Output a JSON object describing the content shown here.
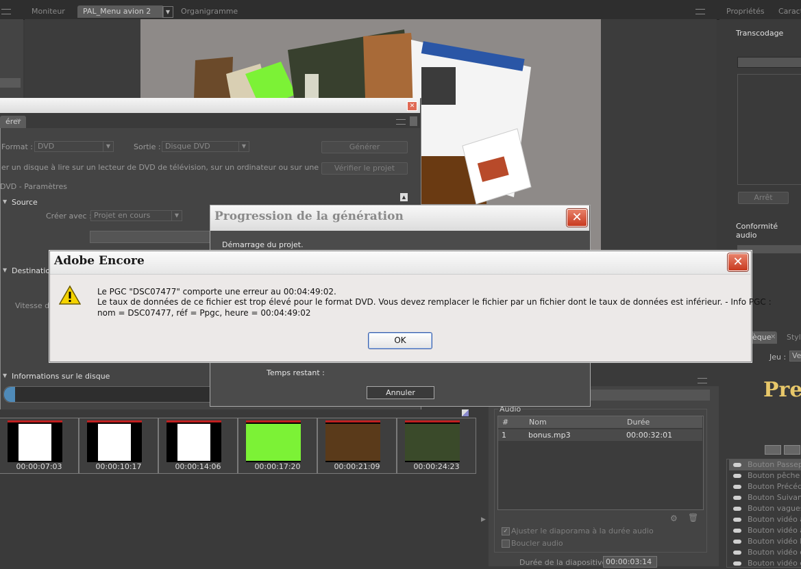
{
  "top_tabs": {
    "monitor": "Moniteur",
    "menu": "PAL_Menu avion 2",
    "org": "Organigramme",
    "props": "Propriétés",
    "charac": "Caract"
  },
  "right_panel": {
    "transcode_label": "Transcodage",
    "stop_button": "Arrêt",
    "audio_conformity": "Conformité audio",
    "game_label": "Jeu :",
    "game_value": "Ve",
    "preset_tab": "èque",
    "style_tab": "Style",
    "preview_text": "Pre",
    "items": [
      "Bouton Passepo",
      "Bouton pêche 1",
      "Bouton Précéde",
      "Bouton Suivant",
      "Bouton vagues",
      "Bouton vidéo ar",
      "Bouton vidéo av",
      "Bouton vidéo bo",
      "Bouton vidéo ca",
      "Bouton vidéo en"
    ]
  },
  "build_panel": {
    "tab_label": "érer",
    "format_label": "Format :",
    "format_value": "DVD",
    "output_label": "Sortie :",
    "output_value": "Disque DVD",
    "generate_button": "Générer",
    "description": "er un disque à lire sur un lecteur de DVD de télévision, sur un ordinateur ou sur une console d...",
    "verify_button": "Vérifier le projet",
    "dvd_params": "DVD - Paramètres",
    "source_label": "Source",
    "create_with_label": "Créer avec :",
    "create_with_value": "Projet en cours",
    "destination_label": "Destination",
    "speed_label": "Vitesse de",
    "disk_info_label": "Informations sur le disque"
  },
  "slides": {
    "times": [
      "00:00:07:03",
      "00:00:10:17",
      "00:00:14:06",
      "00:00:17:20",
      "00:00:21:09",
      "00:00:24:23"
    ]
  },
  "audio_panel": {
    "title": "Audio",
    "col_num": "#",
    "col_name": "Nom",
    "col_duration": "Durée",
    "rows": [
      {
        "num": "1",
        "name": "bonus.mp3",
        "duration": "00:00:32:01"
      }
    ],
    "adjust_label": "Ajuster le diaporama à la durée audio",
    "loop_label": "Boucler audio",
    "slide_duration_label": "Durée de la diapositive :",
    "slide_duration_value": "00:00:03:14"
  },
  "progress_dialog": {
    "title": "Progression de la génération",
    "status": "Démarrage du projet.",
    "remaining_label": "Temps restant :",
    "cancel_button": "Annuler"
  },
  "error_dialog": {
    "title": "Adobe Encore",
    "line1": "Le PGC \"DSC07477\" comporte une erreur au 00:04:49:02.",
    "line2": "Le taux de données de ce fichier est trop élevé pour le format DVD. Vous devez remplacer le fichier par un fichier dont le taux de données est inférieur. - Info PGC :",
    "line3": "nom = DSC07477, réf = Ppgc, heure = 00:04:49:02",
    "ok_button": "OK"
  },
  "colors": {
    "app_bg": "#3a3a3a",
    "dialog_bg": "#ece9d8",
    "dialog_title_bg": "#f4f4f4",
    "ok_border": "#3c5fa8",
    "warning": "#f5d300"
  }
}
